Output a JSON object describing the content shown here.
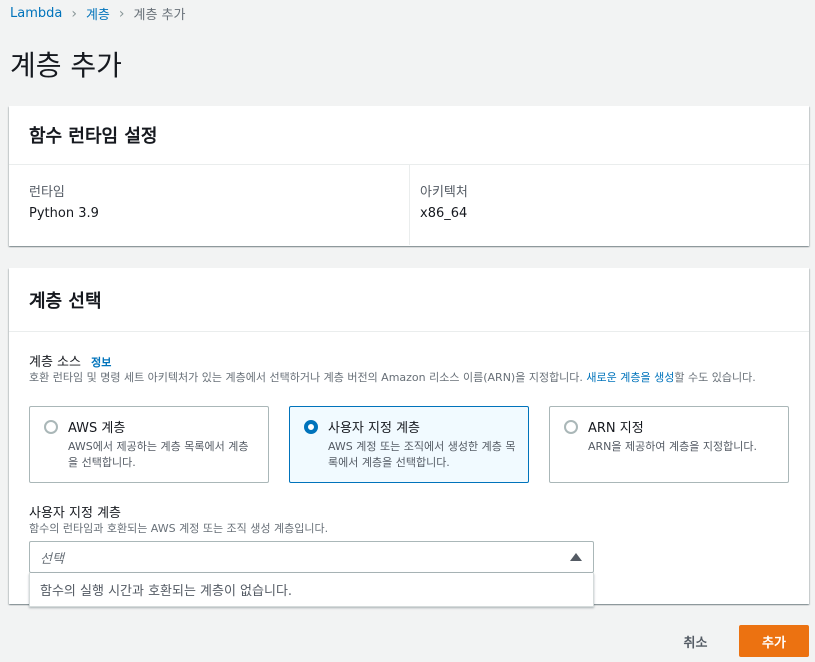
{
  "breadcrumb": {
    "items": [
      "Lambda",
      "계층"
    ],
    "current": "계층 추가"
  },
  "page": {
    "title": "계층 추가"
  },
  "runtime_card": {
    "title": "함수 런타임 설정",
    "runtime_label": "런타임",
    "runtime_value": "Python 3.9",
    "arch_label": "아키텍처",
    "arch_value": "x86_64"
  },
  "layer_card": {
    "title": "계층 선택",
    "source_label": "계층 소스",
    "info_link": "정보",
    "source_desc": "호환 런타임 및 명령 세트 아키텍처가 있는 계층에서 선택하거나 계층 버전의 Amazon 리소스 이름(ARN)을 지정합니다.",
    "source_desc_link": "새로운 계층을 생성",
    "source_desc_tail": "할 수도 있습니다.",
    "options": [
      {
        "title": "AWS 계층",
        "desc": "AWS에서 제공하는 계층 목록에서 계층을 선택합니다.",
        "selected": false
      },
      {
        "title": "사용자 지정 계층",
        "desc": "AWS 계정 또는 조직에서 생성한 계층 목록에서 계층을 선택합니다.",
        "selected": true
      },
      {
        "title": "ARN 지정",
        "desc": "ARN을 제공하여 계층을 지정합니다.",
        "selected": false
      }
    ],
    "custom_label": "사용자 지정 계층",
    "custom_desc": "함수의 런타임과 호환되는 AWS 계정 또는 조직 생성 계층입니다.",
    "select_placeholder": "선택",
    "dropdown_empty": "함수의 실행 시간과 호환되는 계층이 없습니다."
  },
  "actions": {
    "cancel": "취소",
    "add": "추가"
  },
  "colors": {
    "link": "#0073bb",
    "primary": "#ec7211",
    "selected_border": "#0073bb"
  }
}
